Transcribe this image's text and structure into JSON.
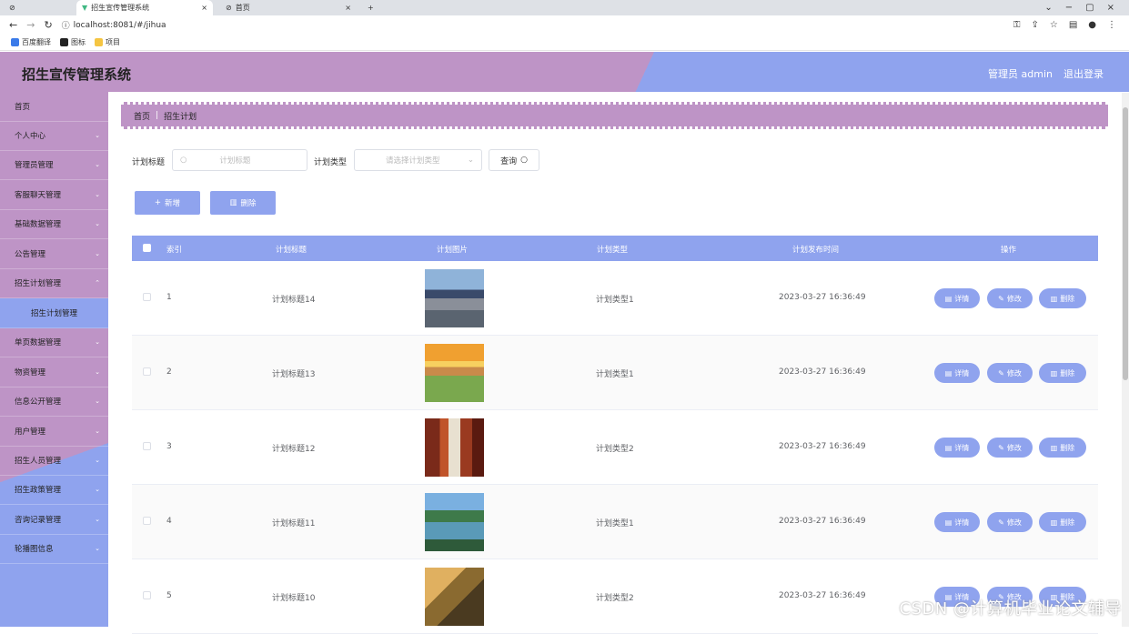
{
  "browser": {
    "tabs": [
      {
        "label": "招生宣传管理系统",
        "active": true
      },
      {
        "label": "首页",
        "active": false
      }
    ],
    "url": "localhost:8081/#/jihua",
    "bookmarks": [
      "百度翻译",
      "图标",
      "项目"
    ]
  },
  "header": {
    "title": "招生宣传管理系统",
    "user_label": "管理员 admin",
    "logout_label": "退出登录"
  },
  "sidebar": {
    "items": [
      {
        "label": "首页"
      },
      {
        "label": "个人中心"
      },
      {
        "label": "管理员管理"
      },
      {
        "label": "客服聊天管理"
      },
      {
        "label": "基础数据管理"
      },
      {
        "label": "公告管理"
      },
      {
        "label": "招生计划管理"
      },
      {
        "label": "招生计划管理"
      },
      {
        "label": "单页数据管理"
      },
      {
        "label": "物资管理"
      },
      {
        "label": "信息公开管理"
      },
      {
        "label": "用户管理"
      },
      {
        "label": "招生人员管理"
      },
      {
        "label": "招生政策管理"
      },
      {
        "label": "咨询记录管理"
      },
      {
        "label": "轮播图信息"
      }
    ]
  },
  "breadcrumb": {
    "home": "首页",
    "separator": "|",
    "current": "招生计划"
  },
  "search": {
    "title_label": "计划标题",
    "title_placeholder": "计划标题",
    "type_label": "计划类型",
    "type_placeholder": "请选择计划类型",
    "query_label": "查询"
  },
  "actions": {
    "add_label": "新增",
    "delete_label": "删除"
  },
  "table": {
    "headers": [
      "索引",
      "计划标题",
      "计划图片",
      "计划类型",
      "计划发布时间",
      "操作"
    ],
    "rows": [
      {
        "index": "1",
        "title": "计划标题14",
        "type": "计划类型1",
        "time": "2023-03-27 16:36:49"
      },
      {
        "index": "2",
        "title": "计划标题13",
        "type": "计划类型1",
        "time": "2023-03-27 16:36:49"
      },
      {
        "index": "3",
        "title": "计划标题12",
        "type": "计划类型2",
        "time": "2023-03-27 16:36:49"
      },
      {
        "index": "4",
        "title": "计划标题11",
        "type": "计划类型1",
        "time": "2023-03-27 16:36:49"
      },
      {
        "index": "5",
        "title": "计划标题10",
        "type": "计划类型2",
        "time": "2023-03-27 16:36:49"
      }
    ],
    "row_actions": {
      "detail": "详情",
      "edit": "修改",
      "delete": "删除"
    }
  },
  "watermark": "CSDN @计算机毕业论文辅导",
  "colors": {
    "pink": "#be94c6",
    "blue": "#8fa3ee"
  }
}
